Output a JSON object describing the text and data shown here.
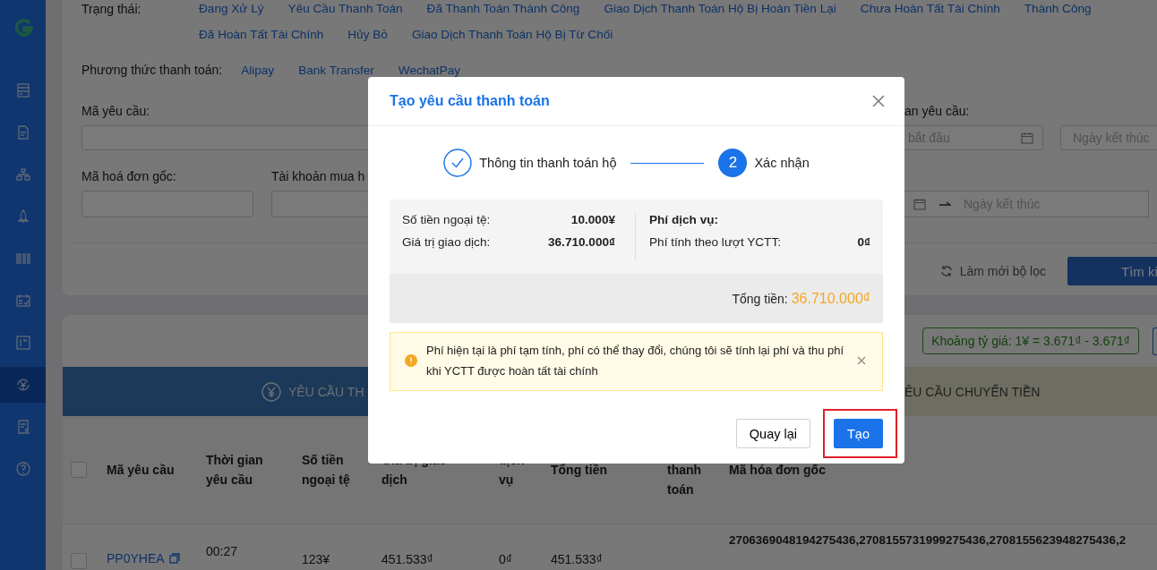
{
  "sidebar": {
    "items": [
      {
        "selected": false
      },
      {
        "selected": false
      },
      {
        "selected": false
      },
      {
        "selected": false
      },
      {
        "selected": false
      },
      {
        "selected": false
      },
      {
        "selected": false
      },
      {
        "selected": true
      },
      {
        "selected": false
      },
      {
        "selected": false
      }
    ]
  },
  "filters": {
    "status_label": "Trạng thái:",
    "statuses": [
      "Đang Xử Lý",
      "Yêu Cầu Thanh Toán",
      "Đã Thanh Toán Thành Công",
      "Giao Dịch Thanh Toán Hộ Bị Hoàn Tiền Lại",
      "Chưa Hoàn Tất Tài Chính",
      "Thành Công",
      "Đã Hoàn Tất Tài Chính",
      "Hủy Bỏ",
      "Giao Dịch Thanh Toán Hộ Bị Từ Chối"
    ],
    "payment_label": "Phương thức thanh toán:",
    "payment_methods": [
      "Alipay",
      "Bank Transfer",
      "WechatPay"
    ],
    "request_code": {
      "label": "Mã yêu cầu:"
    },
    "request_time": {
      "label": "an yêu cầu:",
      "start_placeholder": "bắt đầu",
      "end_placeholder": "Ngày kết thúc"
    },
    "invoice_code": {
      "label": "Mã hoá đơn gốc:"
    },
    "account": {
      "label": "Tài khoản mua h"
    },
    "date_range": {
      "end_placeholder": "Ngày kết thúc"
    },
    "reset": "Làm mới bộ lọc",
    "search_button": "Tìm ki"
  },
  "rate_badge": "Khoảng tỷ giá: 1¥ = 3.671₫ - 3.671₫",
  "tabs": [
    {
      "label": "YÊU CẦU TH",
      "selected": true
    },
    {
      "label": "ÊU CẦU CHUYỂN TIỀN",
      "selected": false
    }
  ],
  "table": {
    "header_checked": false,
    "columns": [
      "Mã yêu cầu",
      "Thời gian yêu cầu",
      "Số tiền ngoại tệ",
      "Giá trị giao dịch",
      "dịch vụ",
      "Tổng tiền",
      "thanh toán",
      "Mã hóa đơn gốc"
    ],
    "rows": [
      {
        "checked": false,
        "code": "PP0YHEA",
        "time": "00:27",
        "foreign": "123¥",
        "value": "451.533₫",
        "fee": "0₫",
        "total": "451.533₫",
        "invoice": "2706369048194275436,2708155731999275436,2708155623948275436,2"
      }
    ]
  },
  "modal": {
    "title": "Tạo yêu cầu thanh toán",
    "steps": [
      {
        "label": "Thông tin thanh toán hộ",
        "done": true
      },
      {
        "label": "Xác nhận",
        "number": "2",
        "done": false
      }
    ],
    "amounts": [
      {
        "label": "Số tiền ngoại tệ:",
        "value": "10.000¥"
      },
      {
        "label": "Giá trị giao dịch:",
        "value": "36.710.000₫"
      }
    ],
    "fee_title": "Phí dịch vụ:",
    "fees": [
      {
        "label": "Phí tính theo lượt YCTT:",
        "value": "0₫"
      }
    ],
    "total_label": "Tổng tiền:",
    "total_value": "36.710.000₫",
    "alert": "Phí hiện tại là phí tạm tính, phí có thể thay đổi, chúng tôi sẽ tính lại phí và thu phí khi YCTT được hoàn tất tài chính",
    "buttons": [
      {
        "label": "Quay lại",
        "kind": "default",
        "highlighted": false
      },
      {
        "label": "Tạo",
        "kind": "primary",
        "highlighted": true
      }
    ]
  }
}
